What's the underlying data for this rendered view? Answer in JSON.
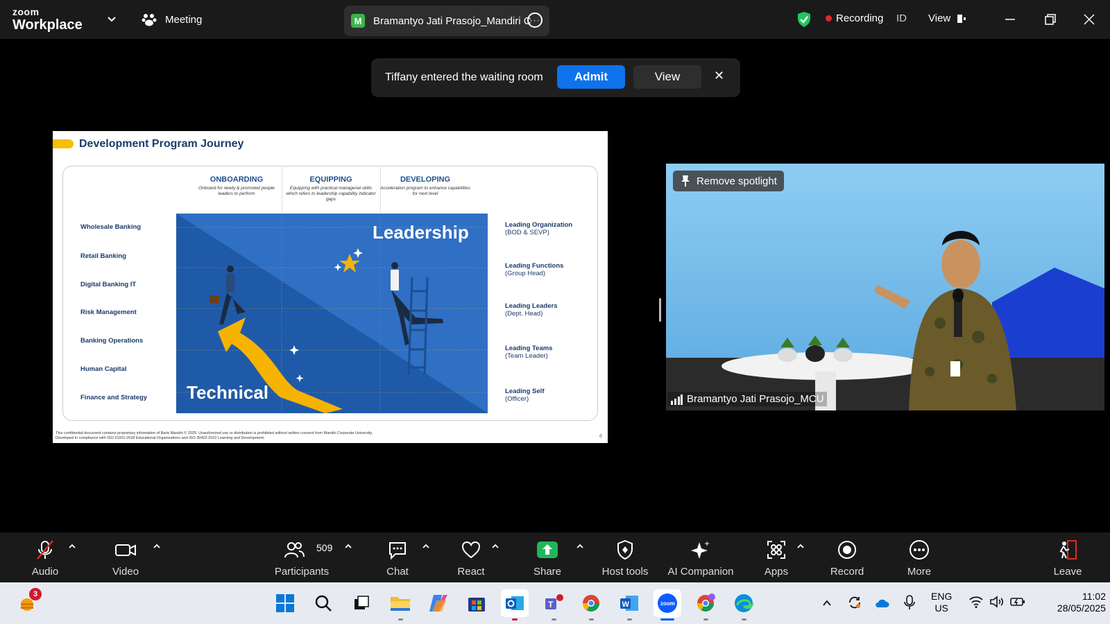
{
  "topbar": {
    "logo_line1": "zoom",
    "logo_line2": "Workplace",
    "meeting_label": "Meeting",
    "speaker_initial": "M",
    "speaker_pill": "Bramantyo Jati Prasojo_Mandiri C",
    "recording_label": "Recording",
    "id_label": "ID",
    "view_label": "View"
  },
  "notification": {
    "message": "Tiffany entered the waiting room",
    "admit_label": "Admit",
    "view_label": "View",
    "close_label": "✕"
  },
  "slide": {
    "title": "Development Program Journey",
    "phases": [
      {
        "name": "ONBOARDING",
        "desc": "Onboard for newly & promoted people leaders to perform"
      },
      {
        "name": "EQUIPPING",
        "desc": "Equipping with practical managerial skills which refers to leadership capability indicator gaps"
      },
      {
        "name": "DEVELOPING",
        "desc": "Acceleration program to enhance capabilities for next level"
      }
    ],
    "left_labels": [
      "Wholesale Banking",
      "Retail Banking",
      "Digital Banking IT",
      "Risk Management",
      "Banking Operations",
      "Human Capital",
      "Finance and Strategy"
    ],
    "right_labels": [
      {
        "title": "Leading Organization",
        "sub": "(BOD & SEVP)"
      },
      {
        "title": "Leading Functions",
        "sub": "(Group Head)"
      },
      {
        "title": "Leading Leaders",
        "sub": "(Dept. Head)"
      },
      {
        "title": "Leading Teams",
        "sub": "(Team Leader)"
      },
      {
        "title": "Leading Self",
        "sub": "(Officer)"
      }
    ],
    "leadership_text": "Leadership",
    "technical_text": "Technical",
    "footer_line1": "This confidential document contains proprietary information of Bank Mandiri © 2025. Unauthorized use or distribution is prohibited without written consent from Mandiri Corporate University.",
    "footer_line2": "Developed in compliance with ISO 21001:2018 Educational Organizations and ISO 30422:2022 Learning and Development.",
    "page_number": "6"
  },
  "video": {
    "spotlight_label": "Remove spotlight",
    "participant_name": "Bramantyo Jati Prasojo_MCU"
  },
  "toolbar": {
    "audio": "Audio",
    "video": "Video",
    "participants": "Participants",
    "participants_count": "509",
    "chat": "Chat",
    "react": "React",
    "share": "Share",
    "host_tools": "Host tools",
    "ai_companion": "AI Companion",
    "apps": "Apps",
    "record": "Record",
    "more": "More",
    "leave": "Leave"
  },
  "taskbar": {
    "weather_badge": "3",
    "lang_line1": "ENG",
    "lang_line2": "US",
    "time": "11:02",
    "date": "28/05/2025"
  },
  "colors": {
    "admit_blue": "#0e72ed",
    "share_green": "#1fb65a",
    "recording_red": "#e02828",
    "slide_navy": "#1b3a6b",
    "accent_yellow": "#f6c000"
  }
}
